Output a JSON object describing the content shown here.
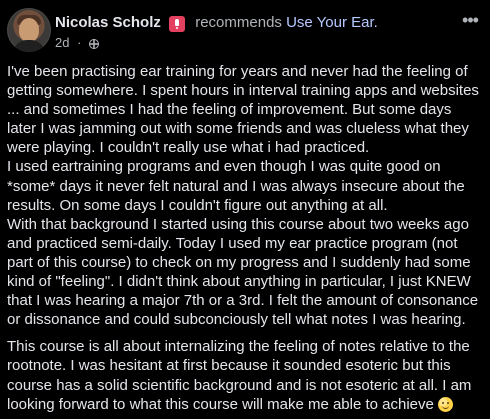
{
  "post": {
    "author": "Nicolas Scholz",
    "action": "recommends",
    "page": "Use Your Ear.",
    "time": "2d",
    "privacy": "globe-icon",
    "menu_icon": "more-options-icon",
    "paragraphs": [
      "I've been practising ear training for years and never had the feeling of getting somewhere. I spent hours in interval training apps and websites ... and sometimes I had the feeling of improvement. But some days later I was jamming out with some friends and was clueless what they were playing. I couldn't really use what i had practiced.",
      "I used eartraining programs and even though I was quite good on *some* days it never felt natural and I was always insecure about the results. On some days I couldn't figure out anything at all.",
      "With that background I started using this course about two weeks ago and practiced semi-daily. Today I used my ear practice program (not part of this course) to check on my progress and I suddenly had some kind of \"feeling\". I didn't think about anything in particular, I just KNEW that I was hearing a major 7th or a 3rd. I felt the amount of consonance or dissonance and could subconciously tell what notes I was hearing.",
      "This course is all about internalizing the feeling of notes relative to the rootnote. I was hesitant at first because it sounded esoteric but this course has a solid scientific background and is not esoteric at all. I am looking forward to what this course will make me able to achieve"
    ]
  },
  "colors": {
    "background": "#000000",
    "text": "#e4e6eb",
    "secondary_text": "#b0b3b8",
    "link": "#b7c9ff",
    "badge": "#e4405f"
  }
}
